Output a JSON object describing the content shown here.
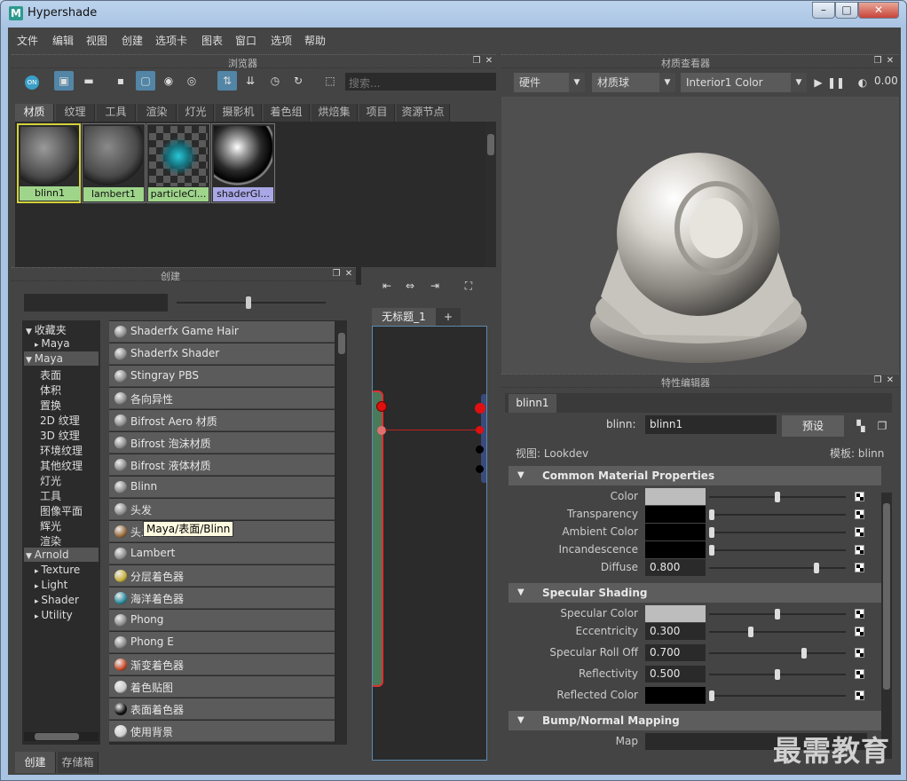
{
  "window": {
    "title": "Hypershade",
    "app_icon": "M",
    "btn_min": "–",
    "btn_max": "□",
    "btn_close": "✕"
  },
  "menu": [
    "文件",
    "编辑",
    "视图",
    "创建",
    "选项卡",
    "图表",
    "窗口",
    "选项",
    "帮助"
  ],
  "browser": {
    "title": "浏览器",
    "search_placeholder": "搜索...",
    "on_label": "ON",
    "tabs": [
      "材质",
      "纹理",
      "工具",
      "渲染",
      "灯光",
      "摄影机",
      "着色组",
      "烘焙集",
      "项目",
      "资源节点"
    ],
    "swatches": [
      {
        "label": "blinn1",
        "color": "#9fd58b"
      },
      {
        "label": "lambert1",
        "color": "#9fd58b"
      },
      {
        "label": "particleCl...",
        "color": "#9fd58b"
      },
      {
        "label": "shaderGl...",
        "color": "#a9a7e6"
      }
    ]
  },
  "create": {
    "title": "创建",
    "tree": [
      {
        "label": "收藏夹",
        "kind": "group"
      },
      {
        "label": "Maya",
        "kind": "child"
      },
      {
        "label": "Maya",
        "kind": "group-sel"
      },
      {
        "label": "表面",
        "kind": "leaf"
      },
      {
        "label": "体积",
        "kind": "leaf"
      },
      {
        "label": "置换",
        "kind": "leaf"
      },
      {
        "label": "2D 纹理",
        "kind": "leaf"
      },
      {
        "label": "3D 纹理",
        "kind": "leaf"
      },
      {
        "label": "环境纹理",
        "kind": "leaf"
      },
      {
        "label": "其他纹理",
        "kind": "leaf"
      },
      {
        "label": "灯光",
        "kind": "leaf"
      },
      {
        "label": "工具",
        "kind": "leaf"
      },
      {
        "label": "图像平面",
        "kind": "leaf"
      },
      {
        "label": "辉光",
        "kind": "leaf"
      },
      {
        "label": "渲染",
        "kind": "leaf"
      },
      {
        "label": "Arnold",
        "kind": "group-sel"
      },
      {
        "label": "Texture",
        "kind": "child"
      },
      {
        "label": "Light",
        "kind": "child"
      },
      {
        "label": "Shader",
        "kind": "child"
      },
      {
        "label": "Utility",
        "kind": "child"
      }
    ],
    "items": [
      {
        "label": "Shaderfx Game Hair",
        "icon": "#8a8a8a"
      },
      {
        "label": "Shaderfx Shader",
        "icon": "#8a8a8a"
      },
      {
        "label": "Stingray PBS",
        "icon": "#8a8a8a"
      },
      {
        "label": "各向异性",
        "icon": "#8a8a8a"
      },
      {
        "label": "Bifrost Aero 材质",
        "icon": "#8a8a8a"
      },
      {
        "label": "Bifrost 泡沫材质",
        "icon": "#8a8a8a"
      },
      {
        "label": "Bifrost 液体材质",
        "icon": "#8a8a8a"
      },
      {
        "label": "Blinn",
        "icon": "#8a8a8a"
      },
      {
        "label": "头发",
        "icon": "#8a8a8a"
      },
      {
        "label": "头发管着色器",
        "icon": "#9a6a3a"
      },
      {
        "label": "Lambert",
        "icon": "#8a8a8a"
      },
      {
        "label": "分层着色器",
        "icon": "#c8b03a"
      },
      {
        "label": "海洋着色器",
        "icon": "#2a8ca0"
      },
      {
        "label": "Phong",
        "icon": "#8a8a8a"
      },
      {
        "label": "Phong E",
        "icon": "#8a8a8a"
      },
      {
        "label": "渐变着色器",
        "icon": "#c84a2a"
      },
      {
        "label": "着色贴图",
        "icon": "#c8c8c8"
      },
      {
        "label": "表面着色器",
        "icon": "#111111"
      },
      {
        "label": "使用背景",
        "icon": "#d0d0d0"
      }
    ],
    "tooltip": "Maya/表面/Blinn",
    "bottom_tabs": [
      "创建",
      "存储箱"
    ]
  },
  "graph": {
    "tab": "无标题_1",
    "add_tab": "+"
  },
  "viewer": {
    "title": "材质查看器",
    "renderer": "硬件",
    "geometry": "材质球",
    "env": "Interior1 Color",
    "value": "0.00"
  },
  "attr": {
    "title": "特性编辑器",
    "tab": "blinn1",
    "node_type_label": "blinn:",
    "node_name": "blinn1",
    "preset_btn": "预设",
    "view_label": "视图:",
    "view_value": "Lookdev",
    "template_label": "模板:",
    "template_value": "blinn",
    "sections": {
      "common": "Common Material Properties",
      "specular": "Specular Shading",
      "bump": "Bump/Normal Mapping"
    },
    "common_rows": [
      {
        "label": "Color",
        "kind": "color",
        "swatch": "#bdbdbd",
        "slider": 0.5
      },
      {
        "label": "Transparency",
        "kind": "color",
        "swatch": "#000000",
        "slider": 0.0
      },
      {
        "label": "Ambient Color",
        "kind": "color",
        "swatch": "#000000",
        "slider": 0.0
      },
      {
        "label": "Incandescence",
        "kind": "color",
        "swatch": "#000000",
        "slider": 0.0
      },
      {
        "label": "Diffuse",
        "kind": "value",
        "value": "0.800",
        "slider": 0.8
      }
    ],
    "spec_rows": [
      {
        "label": "Specular Color",
        "kind": "color",
        "swatch": "#bdbdbd",
        "slider": 0.5
      },
      {
        "label": "Eccentricity",
        "kind": "value",
        "value": "0.300",
        "slider": 0.3
      },
      {
        "label": "Specular Roll Off",
        "kind": "value",
        "value": "0.700",
        "slider": 0.7
      },
      {
        "label": "Reflectivity",
        "kind": "value",
        "value": "0.500",
        "slider": 0.5
      },
      {
        "label": "Reflected Color",
        "kind": "color",
        "swatch": "#000000",
        "slider": 0.0
      }
    ],
    "bump_rows": [
      {
        "label": "Map"
      }
    ]
  },
  "watermark": "最需教育"
}
